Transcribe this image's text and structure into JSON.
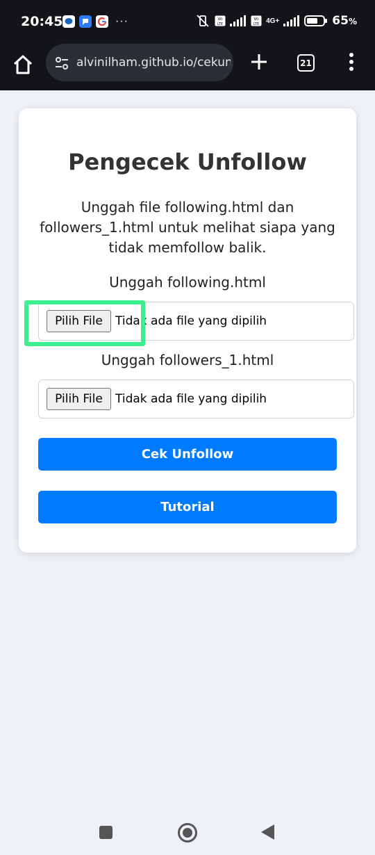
{
  "status_bar": {
    "time": "20:45",
    "notification_icons": [
      "chat-bubble-icon",
      "message-icon",
      "google-icon"
    ],
    "more": "···",
    "network": "4G+",
    "battery": "65",
    "battery_unit": "%"
  },
  "browser": {
    "url": "alvinilham.github.io/cekunf",
    "tab_count": "21"
  },
  "page": {
    "title": "Pengecek Unfollow",
    "description": "Unggah file following.html dan followers_1.html untuk melihat siapa yang tidak memfollow balik.",
    "uploads": [
      {
        "label": "Unggah following.html",
        "button": "Pilih File",
        "status": "Tidak ada file yang dipilih"
      },
      {
        "label": "Unggah followers_1.html",
        "button": "Pilih File",
        "status": "Tidak ada file yang dipilih"
      }
    ],
    "check_button": "Cek Unfollow",
    "tutorial_button": "Tutorial"
  },
  "colors": {
    "primary": "#007bff",
    "highlight": "#3cf08f",
    "page_background": "#eef1f6",
    "browser_bar": "#121417"
  }
}
